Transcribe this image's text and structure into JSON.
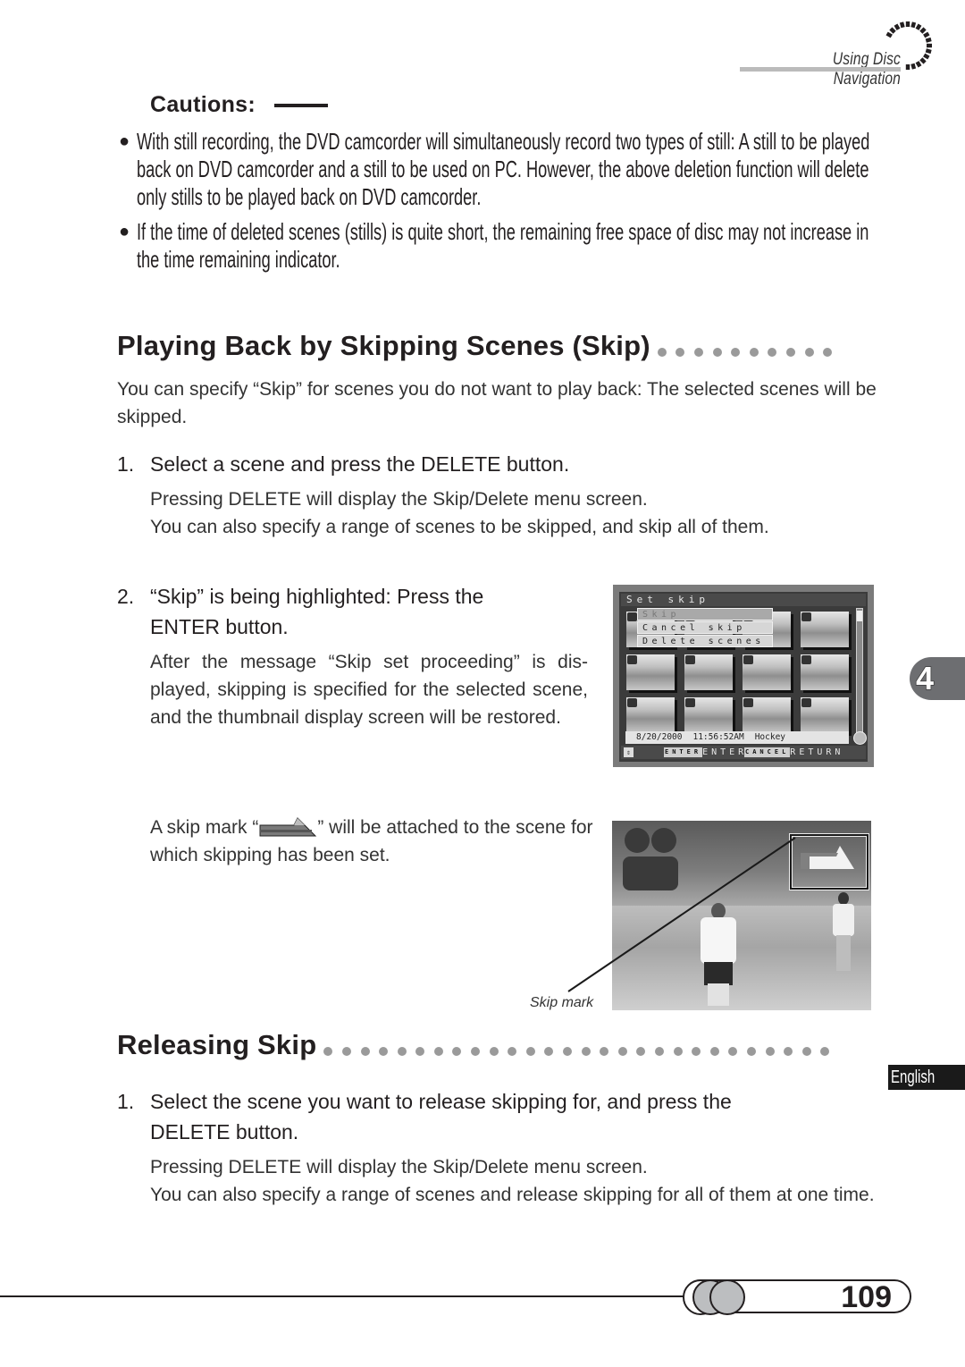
{
  "header": {
    "section_title": "Using Disc Navigation",
    "icon": "dashed-arc-icon"
  },
  "cautions": {
    "title": "Cautions:",
    "items": [
      "With still recording, the DVD camcorder will simultaneously record two types of still: A still to be played back on DVD camcorder and a still to be used on PC. However, the above deletion function will delete only stills to be played back on DVD camcorder.",
      "If the time of deleted scenes (stills) is quite short, the remaining free space of disc may not increase in the time remaining indicator."
    ]
  },
  "section_skip": {
    "heading": "Playing Back by Skipping Scenes (Skip)",
    "intro": "You can specify “Skip” for scenes you do not want to play back: The selected scenes will be skipped.",
    "steps": [
      {
        "number": "1.",
        "title": "Select a scene and press the DELETE button.",
        "body": [
          "Pressing DELETE will display the Skip/Delete menu screen.",
          "You can also specify a range of scenes to be skipped, and skip all of them."
        ]
      },
      {
        "number": "2.",
        "title_line1": "“Skip” is being highlighted: Press the",
        "title_line2": "ENTER button.",
        "body": "After the message “Skip set proceeding” is dis-played, skipping is specified for the selected scene, and the thumbnail display screen will be restored."
      }
    ],
    "skip_mark_text_before": "A skip mark “",
    "skip_mark_text_after": "” will be attached to the scene for which skipping has been set.",
    "skip_mark_icon": "skip-mark-arrow-icon",
    "skip_mark_caption": "Skip mark"
  },
  "camcorder_screen": {
    "title": "Set skip",
    "menu": [
      {
        "label": "Skip",
        "selected": true
      },
      {
        "label": "Cancel skip",
        "selected": false
      },
      {
        "label": "Delete scenes",
        "selected": false
      }
    ],
    "info": {
      "date": "8/20/2000",
      "time": "11:56:52AM",
      "title": "Hockey"
    },
    "footer": {
      "enter_key": "ENTER",
      "enter_label": "ENTER",
      "cancel_key": "CANCEL",
      "cancel_label": "RETURN"
    }
  },
  "section_release": {
    "heading": "Releasing Skip",
    "steps": [
      {
        "number": "1.",
        "title_line1": "Select the scene you want to release skipping for, and press the",
        "title_line2": "DELETE button.",
        "body": [
          "Pressing DELETE will display the Skip/Delete menu screen.",
          "You can also specify a range of scenes and release skipping for all of them at one time."
        ]
      }
    ]
  },
  "side_tabs": {
    "chapter": "4",
    "language": "English"
  },
  "footer": {
    "page_number": "109"
  },
  "colors": {
    "text": "#231f20",
    "dots": "#9a9a9a",
    "chapter_tab": "#6d6e71",
    "language_tab": "#1a1a1a"
  }
}
